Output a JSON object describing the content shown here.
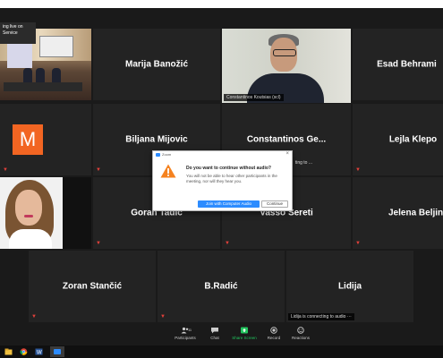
{
  "live_notice": {
    "line1": "ing live on",
    "line2": "Service"
  },
  "participants": {
    "tile_1": {
      "name": "Marija Banožić"
    },
    "tile_speaker": {
      "label": "Constantinos Koutsias (scl)"
    },
    "tile_3": {
      "name": "Esad Behrami"
    },
    "tile_avatar": {
      "initial": "M"
    },
    "tile_5": {
      "name": "Biljana Mijovic"
    },
    "tile_6": {
      "name": "Constantinos  Ge...",
      "sub": "ting to ..."
    },
    "tile_7": {
      "name": "Lejla Klepo"
    },
    "tile_9": {
      "name": "Goran Tadić"
    },
    "tile_10": {
      "name": "Vasso Sereti"
    },
    "tile_11": {
      "name": "Jelena Beljin"
    },
    "tile_12": {
      "name": "Zoran Stančić"
    },
    "tile_13": {
      "name": "B.Radić"
    },
    "tile_14": {
      "name": "Lidija",
      "connecting": "Lidija is connecting to audio ···"
    }
  },
  "dialog": {
    "app_title": "Zoom",
    "heading": "Do you want to continue without audio?",
    "body": "You will not be able to hear other participants in the meeting, nor will they hear you.",
    "primary_button": "Join with Computer Audio",
    "secondary_button": "Continue",
    "warn_icon": "warning-icon"
  },
  "toolbar": {
    "participants_label": "Participants",
    "participants_count": "11",
    "chat_label": "Chat",
    "share_label": "Share Screen",
    "record_label": "Record",
    "reactions_label": "Reactions",
    "share_color": "#22c55e"
  }
}
